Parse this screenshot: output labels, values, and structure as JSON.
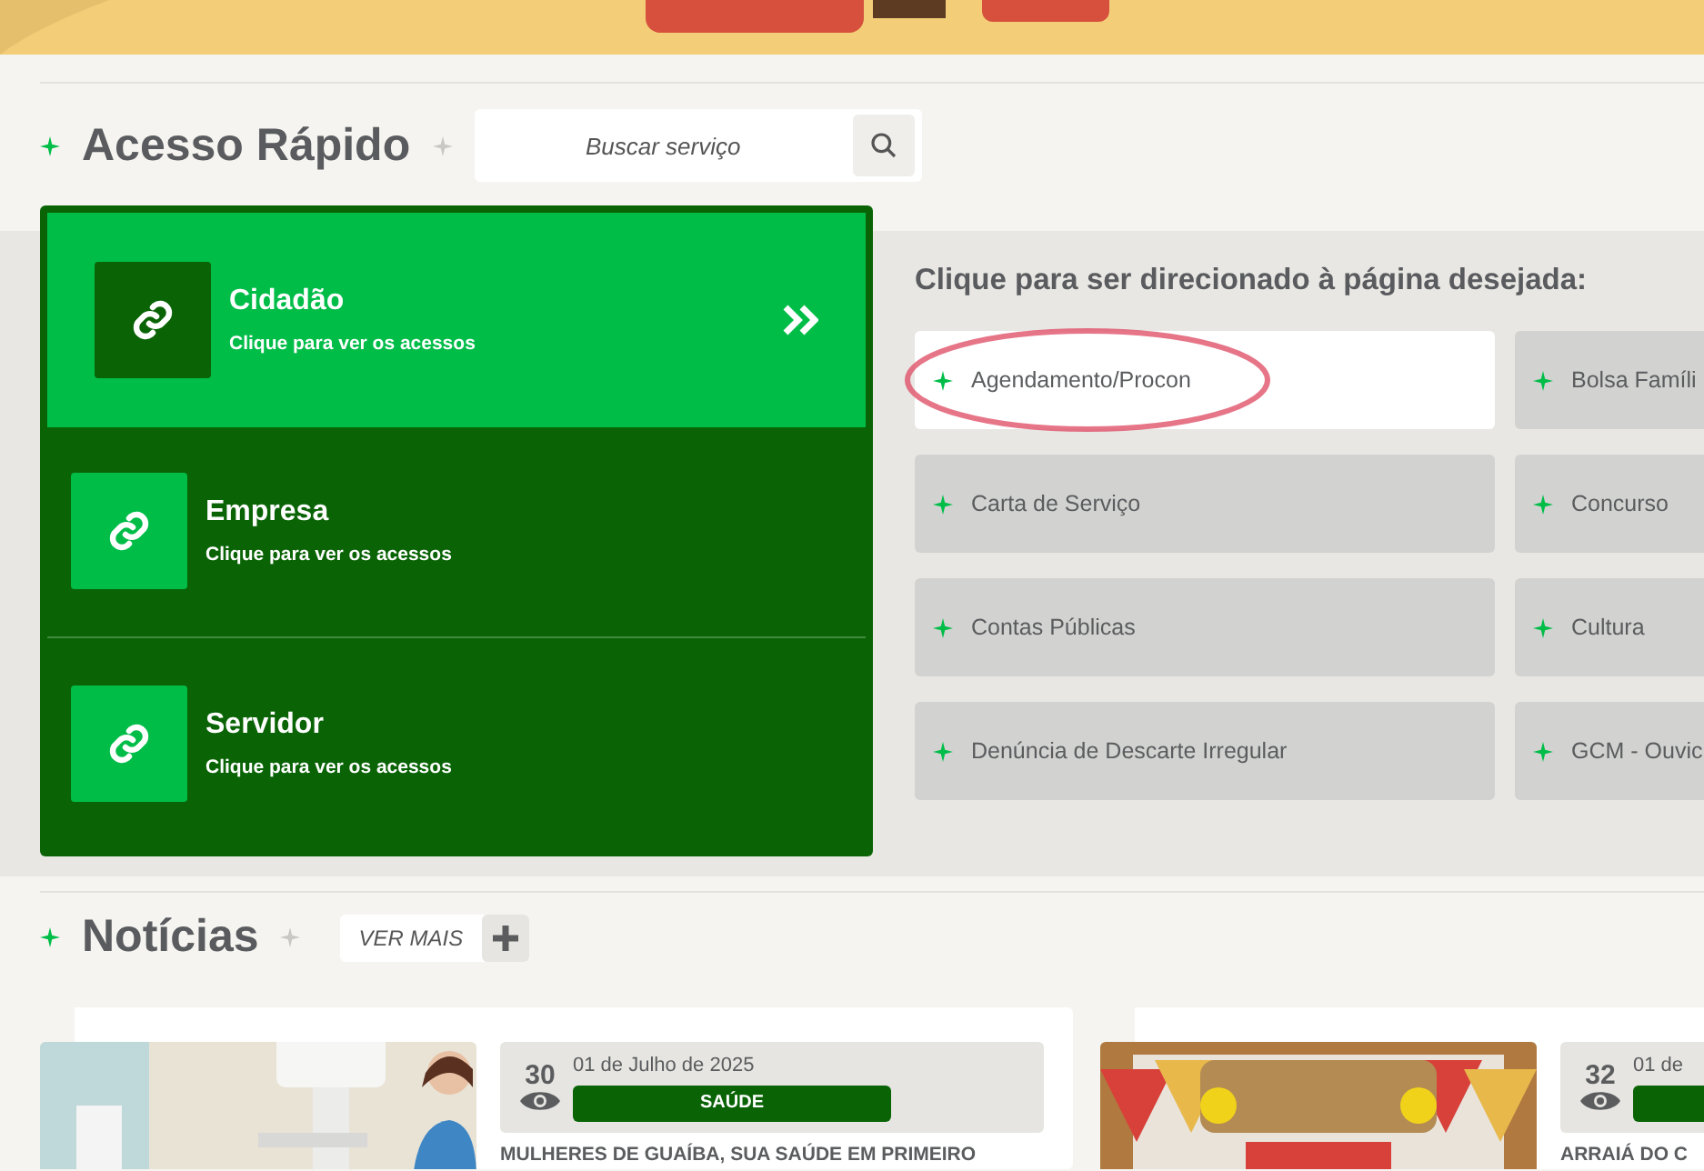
{
  "quick_access": {
    "title": "Acesso Rápido",
    "search": {
      "placeholder": "Buscar serviço"
    },
    "profiles": [
      {
        "name": "Cidadão",
        "subtitle": "Clique para ver os acessos",
        "selected": true
      },
      {
        "name": "Empresa",
        "subtitle": "Clique para ver os acessos",
        "selected": false
      },
      {
        "name": "Servidor",
        "subtitle": "Clique para ver os acessos",
        "selected": false
      }
    ],
    "links_title": "Clique para ser direcionado à página desejada:",
    "links": [
      {
        "label": "Agendamento/Procon",
        "selected": true,
        "circled": true
      },
      {
        "label": "Bolsa Famíli",
        "selected": false,
        "circled": false
      },
      {
        "label": "Carta de Serviço",
        "selected": false,
        "circled": false
      },
      {
        "label": "Concurso",
        "selected": false,
        "circled": false
      },
      {
        "label": "Contas Públicas",
        "selected": false,
        "circled": false
      },
      {
        "label": "Cultura",
        "selected": false,
        "circled": false
      },
      {
        "label": "Denúncia de Descarte Irregular",
        "selected": false,
        "circled": false
      },
      {
        "label": "GCM - Ouvic",
        "selected": false,
        "circled": false
      }
    ]
  },
  "news": {
    "title": "Notícias",
    "more": "VER MAIS",
    "items": [
      {
        "views": "30",
        "date": "01 de Julho de 2025",
        "category": "SAÚDE",
        "headline": "MULHERES DE GUAÍBA, SUA SAÚDE EM PRIMEIRO"
      },
      {
        "views": "32",
        "date": "01 de",
        "headline": "ARRAIÁ DO C"
      }
    ]
  }
}
